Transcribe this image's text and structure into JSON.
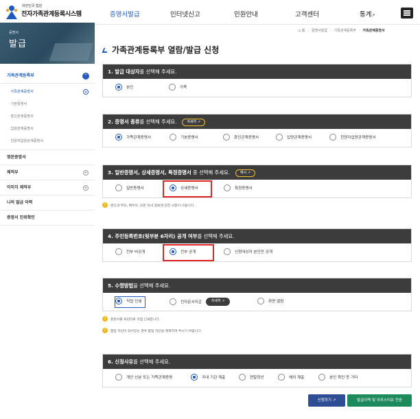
{
  "header": {
    "org_small": "대한민국 법원",
    "org_big": "전자가족관계등록시스템",
    "nav": [
      {
        "label": "증명서발급",
        "active": true
      },
      {
        "label": "인터넷신고",
        "active": false
      },
      {
        "label": "민원안내",
        "active": false
      },
      {
        "label": "고객센터",
        "active": false
      },
      {
        "label": "통계",
        "active": false
      }
    ]
  },
  "breadcrumb": [
    "홈",
    "증명서발급",
    "가족관계등록부",
    "가족관계증명서"
  ],
  "side_banner": {
    "small": "증명서",
    "large": "발급"
  },
  "sidebar": {
    "section_head": "가족관계등록부",
    "sub_items": [
      "가족관계증명서",
      "기본증명서",
      "혼인관계증명서",
      "입양관계증명서",
      "친양자입양관계증명서"
    ],
    "sections": [
      "영문증명서",
      "제적부",
      "이미지 제적부",
      "나의 발급 이력",
      "증명서 진위확인"
    ]
  },
  "page_title": "가족관계등록부 열람/발급 신청",
  "sections": {
    "s1": {
      "bold": "1. 발급 대상자",
      "rest": "를 선택해 주세요.",
      "options": [
        "본인",
        "가족"
      ]
    },
    "s2": {
      "bold": "2. 증명서 종류",
      "rest": "를 선택해 주세요.",
      "detail": "자세히",
      "options": [
        "가족관계증명서",
        "기본증명서",
        "혼인관계증명서",
        "입양관계증명서",
        "친양자입양관계증명서"
      ]
    },
    "s3": {
      "bold": "3. 일반증명서, 상세증명서, 특정증명서",
      "rest": " 중 선택해 주세요.",
      "detail": "예시",
      "options": [
        "일반증명서",
        "상세증명서",
        "특정증명서"
      ],
      "note": "본인과 부모, 배우자, 모든 자녀 정보에 관한 사항이 나옵니다."
    },
    "s4": {
      "bold": "4. 주민등록번호(뒷부분 6자리) 공개 여부",
      "rest": "를 선택해 주세요.",
      "options": [
        "전부 비공개",
        "전부 공개",
        "신청대상자 본인만 공개"
      ]
    },
    "s5": {
      "bold": "5. 수령방법",
      "rest": "을 선택해 주세요.",
      "options": [
        "직접 인쇄",
        "전자문서지갑",
        "화면 열람"
      ],
      "detail": "자세히",
      "notes": [
        "증명서를 프린터로 직접 인쇄합니다.",
        "팝업 차단이 되어있는 경우 팝업 차단을 해제하여 주시기 바랍니다."
      ]
    },
    "s6": {
      "bold": "6. 신청사유",
      "rest": "를 선택해 주세요.",
      "options": [
        "개인 신분 또는 가족관계증명",
        "국내 기관 제출",
        "연말정산",
        "해외 제출",
        "본인 확인 등 기타"
      ]
    }
  },
  "buttons": {
    "apply": "신청하기",
    "history": "발급이력 및 아포스티유 전송"
  },
  "colors": {
    "accent": "#1f5bbf",
    "section_head": "#3c3c3c",
    "highlight": "#e02424",
    "note_icon": "#f0b81c"
  }
}
